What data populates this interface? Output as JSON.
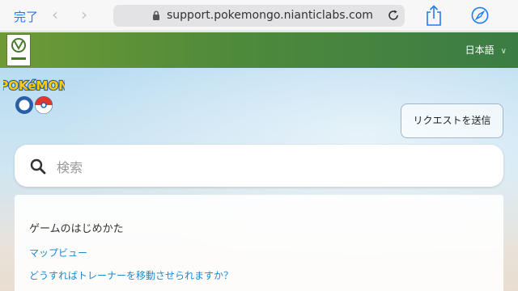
{
  "browser": {
    "done_label": "完了",
    "back_icon": "chevron-left-icon",
    "forward_icon": "chevron-right-icon",
    "url": "support.pokemongo.nianticlabs.com",
    "lock_icon": "lock-icon",
    "reload_icon": "reload-icon",
    "share_icon": "share-icon",
    "compass_icon": "compass-icon",
    "accent_color": "#1f7bf0"
  },
  "header": {
    "logo_icon": "niantic-logo-icon",
    "language": "日本語",
    "band_color": "#4f8a3b"
  },
  "hero": {
    "logo_icon": "pokemon-go-logo",
    "request_button": "リクエストを送信",
    "search": {
      "placeholder": "検索",
      "icon": "search-icon"
    }
  },
  "faq": {
    "heading": "ゲームのはじめかた",
    "links": [
      "マップビュー",
      "どうすればトレーナーを移動させられますか？",
      ""
    ],
    "link_color": "#1b8ad3"
  }
}
